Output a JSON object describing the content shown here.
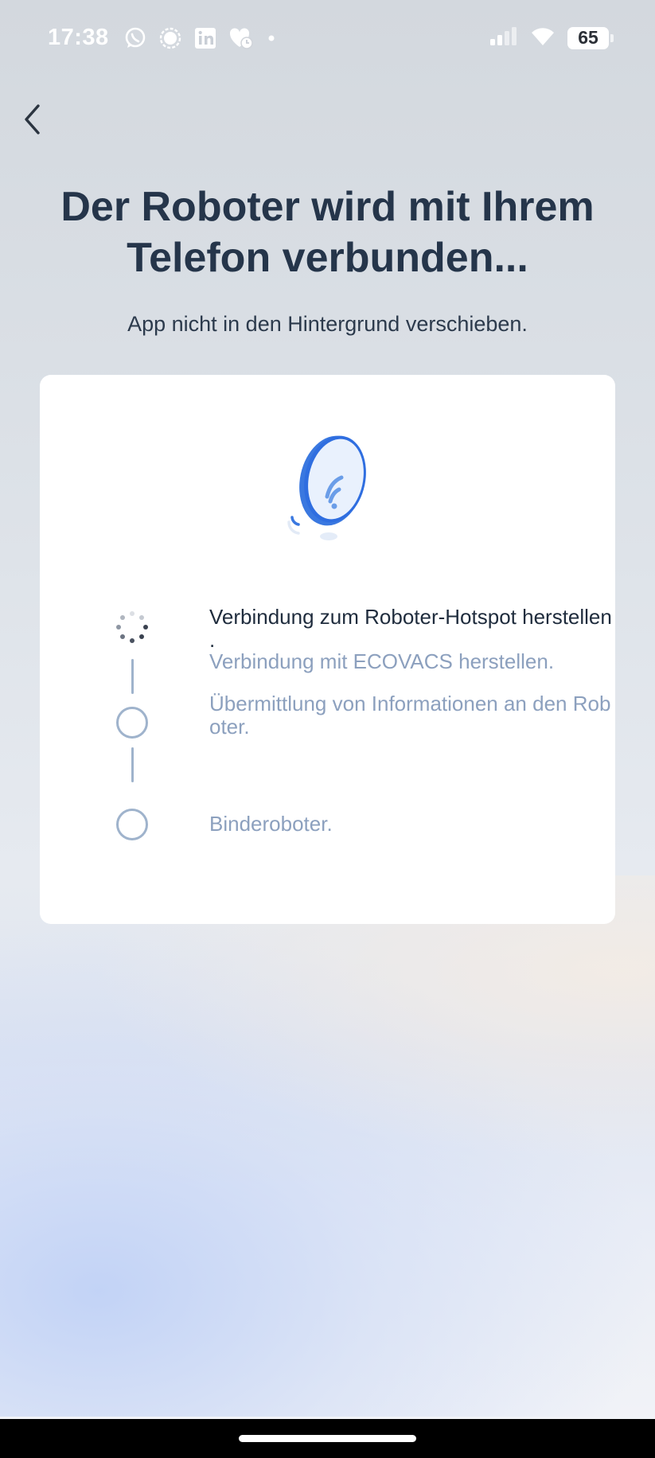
{
  "status_bar": {
    "time": "17:38",
    "battery": "65",
    "notification_icons": [
      "whatsapp-icon",
      "signal-icon",
      "linkedin-icon",
      "health-app-icon",
      "more-dot-icon"
    ],
    "system_icons": [
      "cellular-signal-icon",
      "wifi-icon",
      "battery-icon"
    ]
  },
  "header": {
    "back_icon": "chevron-left-icon",
    "title_line1": "Der Roboter wird mit Ihrem",
    "title_line2": "Telefon verbunden...",
    "subtitle": "App nicht in den Hintergrund verschieben."
  },
  "card": {
    "illustration": "robot-wifi-icon",
    "steps": [
      {
        "line1": "Verbindung zum Roboter-Hotspot herstellen",
        "line2": ".",
        "state": "active"
      },
      {
        "line1": "Verbindung mit ECOVACS herstellen.",
        "state": "pending"
      },
      {
        "line1": "Übermittlung von Informationen an den Rob",
        "line2": "oter.",
        "state": "pending"
      },
      {
        "line1": "Binderoboter.",
        "state": "pending"
      }
    ]
  },
  "colors": {
    "title": "#25354a",
    "active_text": "#1f2c3d",
    "pending_text": "#8ca0be",
    "accent_blue": "#2f6ee0"
  }
}
